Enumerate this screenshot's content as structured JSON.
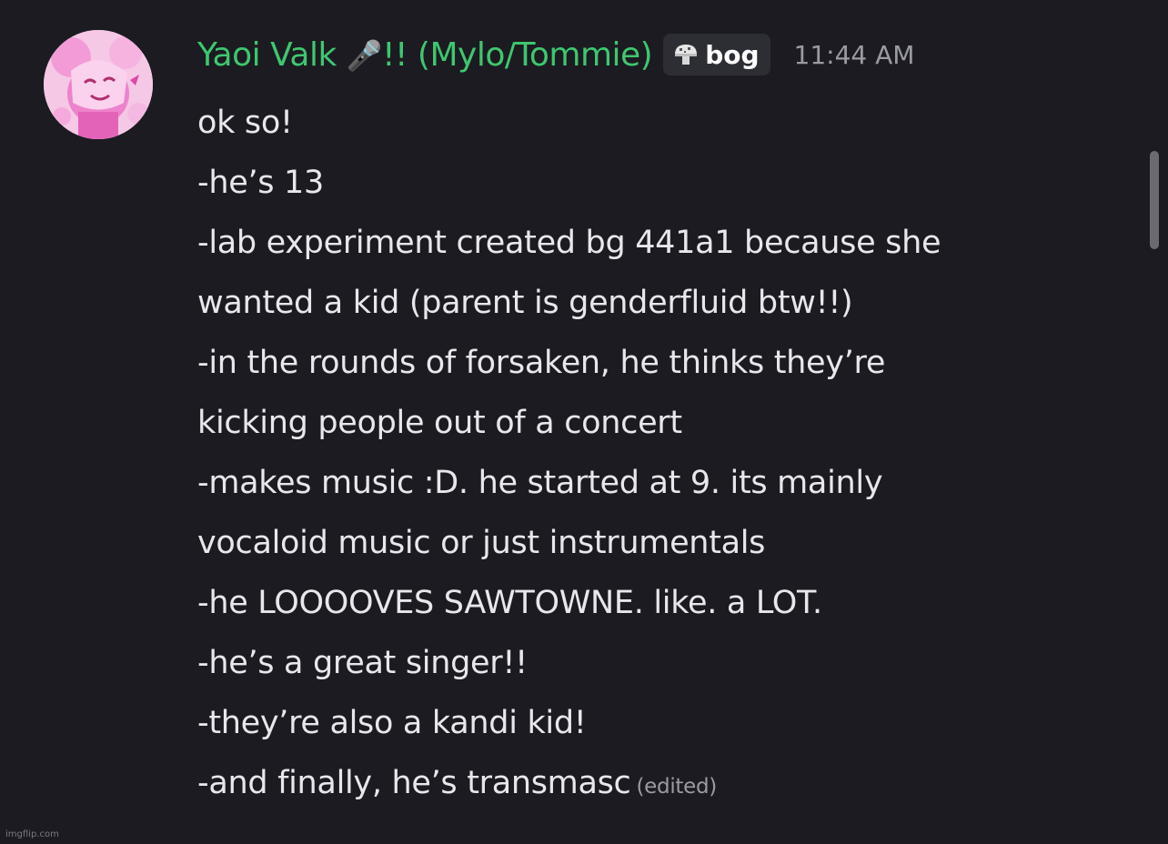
{
  "message": {
    "author": {
      "name": "Yaoi Valk",
      "mic_glyph": "🎤",
      "name_suffix": "!! (Mylo/Tommie)",
      "name_color": "#3ec76f",
      "avatar_icon": "pink-character-avatar"
    },
    "tag": {
      "icon": "mushroom-icon",
      "label": "bog"
    },
    "timestamp": "11:44 AM",
    "lines": [
      "ok so!",
      "-he’s 13",
      "-lab experiment created bg 441a1 because she",
      "wanted a kid (parent is genderfluid btw!!)",
      "-in the rounds of forsaken, he thinks they’re",
      "kicking people out of a concert",
      "-makes music :D. he started at 9. its mainly",
      "vocaloid music or just instrumentals",
      "-he LOOOOVES SAWTOWNE. like. a LOT.",
      "-he’s a great singer!!",
      "-they’re also a kandi kid!",
      "-and finally, he’s transmasc"
    ],
    "edited_label": "(edited)"
  },
  "watermark": "imgflip.com",
  "colors": {
    "background": "#1c1b21",
    "text": "#e8e8ec",
    "muted": "#9a9ba3",
    "tag_bg": "#2d2e34"
  }
}
